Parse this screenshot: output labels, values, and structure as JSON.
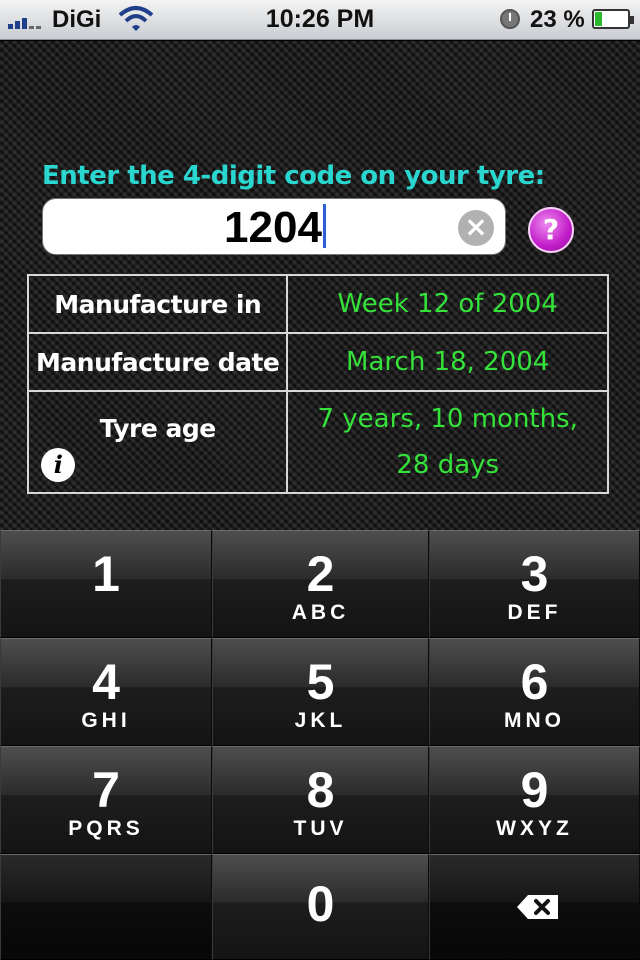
{
  "status_bar": {
    "carrier": "DiGi",
    "time": "10:26 PM",
    "battery_percent": "23 %",
    "battery_level": 0.23,
    "icons": [
      "signal-bars-icon",
      "wifi-icon",
      "alarm-clock-icon",
      "battery-icon"
    ]
  },
  "main": {
    "prompt": "Enter the 4-digit code on your tyre:",
    "code_value": "1204",
    "clear_icon": "×",
    "help_icon": "?",
    "rows": [
      {
        "label": "Manufacture in",
        "value": "Week 12 of 2004"
      },
      {
        "label": "Manufacture date",
        "value": "March 18, 2004"
      },
      {
        "label": "Tyre age",
        "value_line1": "7 years, 10 months,",
        "value_line2": "28 days",
        "info_icon": "i"
      }
    ]
  },
  "keypad": {
    "keys": [
      {
        "digit": "1",
        "letters": ""
      },
      {
        "digit": "2",
        "letters": "ABC"
      },
      {
        "digit": "3",
        "letters": "DEF"
      },
      {
        "digit": "4",
        "letters": "GHI"
      },
      {
        "digit": "5",
        "letters": "JKL"
      },
      {
        "digit": "6",
        "letters": "MNO"
      },
      {
        "digit": "7",
        "letters": "PQRS"
      },
      {
        "digit": "8",
        "letters": "TUV"
      },
      {
        "digit": "9",
        "letters": "WXYZ"
      },
      {
        "digit": "0",
        "letters": ""
      }
    ],
    "backspace_icon": "backspace-icon"
  },
  "colors": {
    "prompt": "#2ad7d0",
    "value_text": "#34e23a",
    "help_button": "#c21dc9",
    "caret": "#2c5fd6"
  }
}
